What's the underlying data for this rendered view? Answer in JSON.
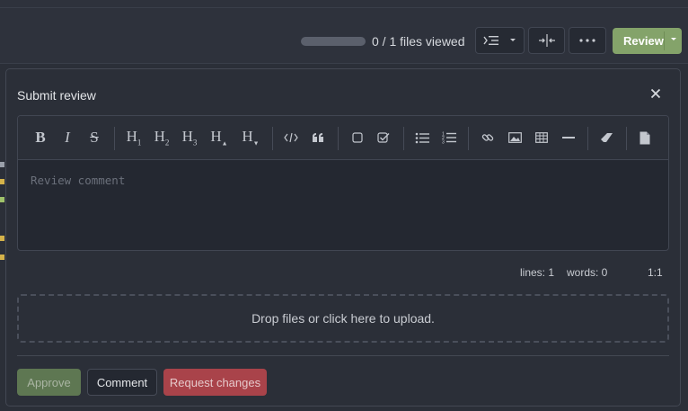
{
  "header": {
    "files_viewed": "0 / 1 files viewed",
    "progress_fraction": 0,
    "review_label": "Review"
  },
  "panel": {
    "title": "Submit review",
    "editor": {
      "placeholder": "Review comment",
      "toolbar": [
        {
          "name": "bold",
          "glyph": "B"
        },
        {
          "name": "italic",
          "glyph": "I"
        },
        {
          "name": "strikethrough",
          "glyph": "S"
        },
        {
          "name": "heading-1",
          "glyph": "H1"
        },
        {
          "name": "heading-2",
          "glyph": "H2"
        },
        {
          "name": "heading-3",
          "glyph": "H3"
        },
        {
          "name": "heading-bigger",
          "glyph": "H▲"
        },
        {
          "name": "heading-smaller",
          "glyph": "H▼"
        },
        {
          "name": "code",
          "glyph": "</>"
        },
        {
          "name": "quote",
          "glyph": "❝"
        },
        {
          "name": "checkbox-empty",
          "glyph": "☐"
        },
        {
          "name": "checkbox-checked",
          "glyph": "☑"
        },
        {
          "name": "unordered-list",
          "glyph": "≡"
        },
        {
          "name": "ordered-list",
          "glyph": "≡"
        },
        {
          "name": "link",
          "glyph": "⛓"
        },
        {
          "name": "image",
          "glyph": "▣"
        },
        {
          "name": "table",
          "glyph": "▦"
        },
        {
          "name": "horizontal-rule",
          "glyph": "—"
        },
        {
          "name": "clean-block",
          "glyph": "◇"
        },
        {
          "name": "document",
          "glyph": "▤"
        }
      ]
    },
    "stats": {
      "lines": "lines: 1",
      "words": "words: 0",
      "cursor": "1:1"
    },
    "dropzone": "Drop files or click here to upload.",
    "buttons": {
      "approve": "Approve",
      "comment": "Comment",
      "request_changes": "Request changes"
    }
  },
  "colors": {
    "approve_bg": "#5e7752",
    "request_changes_bg": "#a9434a",
    "review_bg": "#84a36a"
  }
}
